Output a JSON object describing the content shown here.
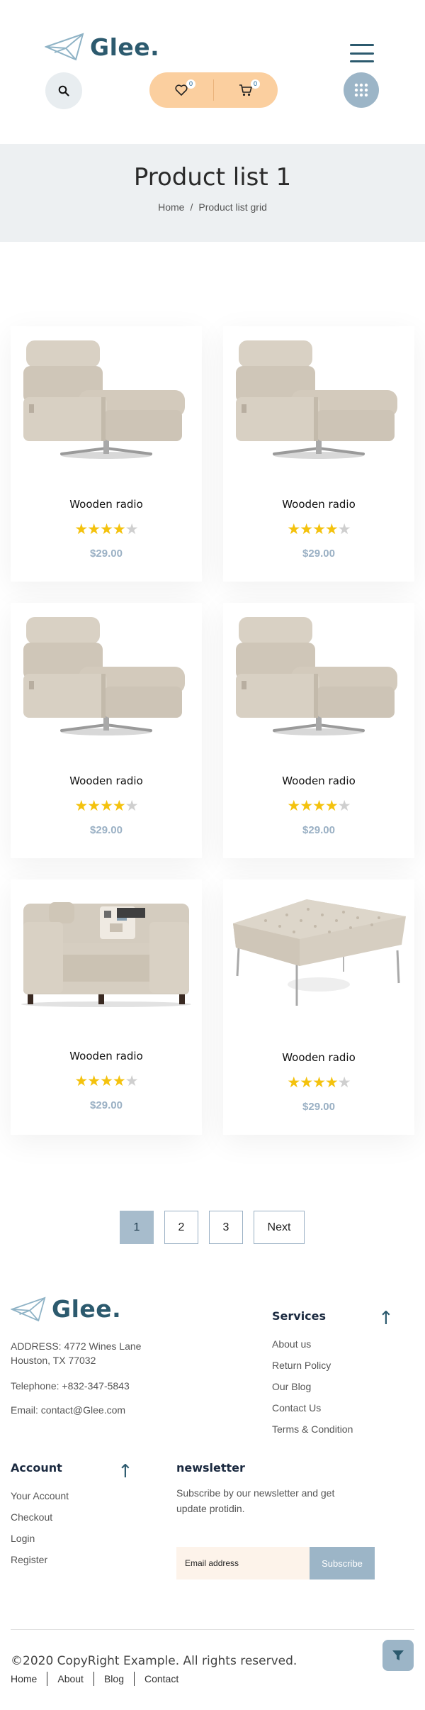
{
  "header": {
    "logo_text": "Glee.",
    "wishlist_count": "0",
    "cart_count": "0",
    "icons": {
      "search": "search-icon",
      "wishlist": "heart-icon",
      "cart": "cart-icon",
      "menu": "hamburger-icon",
      "apps": "grid-icon"
    },
    "colors": {
      "brand": "#2c5a6e",
      "pill": "#fbcf9f",
      "accent": "#9cb5c7"
    }
  },
  "banner": {
    "title": "Product list 1",
    "breadcrumb": [
      "Home",
      "/",
      "Product list grid"
    ]
  },
  "products": [
    {
      "name": "Wooden radio",
      "rating": 4,
      "max_rating": 5,
      "price": "$29.00",
      "image": "armchair-image"
    },
    {
      "name": "Wooden radio",
      "rating": 4,
      "max_rating": 5,
      "price": "$29.00",
      "image": "armchair-image"
    },
    {
      "name": "Wooden radio",
      "rating": 4,
      "max_rating": 5,
      "price": "$29.00",
      "image": "armchair-image"
    },
    {
      "name": "Wooden radio",
      "rating": 4,
      "max_rating": 5,
      "price": "$29.00",
      "image": "armchair-image"
    },
    {
      "name": "Wooden radio",
      "rating": 4,
      "max_rating": 5,
      "price": "$29.00",
      "image": "sofa-image"
    },
    {
      "name": "Wooden radio",
      "rating": 4,
      "max_rating": 5,
      "price": "$29.00",
      "image": "ottoman-image"
    }
  ],
  "pagination": {
    "pages": [
      "1",
      "2",
      "3"
    ],
    "current": "1",
    "next_label": "Next"
  },
  "footer": {
    "logo_text": "Glee.",
    "address_line1": "ADDRESS: 4772 Wines Lane",
    "address_line2": "Houston, TX 77032",
    "telephone": "Telephone: +832-347-5843",
    "email": "Email: contact@Glee.com",
    "services": {
      "heading": "Services",
      "links": [
        "About us",
        "Return Policy",
        "Our Blog",
        "Contact Us",
        "Terms & Condition"
      ]
    },
    "account": {
      "heading": "Account",
      "links": [
        "Your Account",
        "Checkout",
        "Login",
        "Register"
      ]
    },
    "newsletter": {
      "heading": "newsletter",
      "text_line1": "Subscribe by our newsletter and get",
      "text_line2": "update protidin.",
      "placeholder": "Email address",
      "button": "Subscribe"
    },
    "copyright": "©2020 CopyRight Example. All rights reserved.",
    "bottom_links": [
      "Home",
      "About",
      "Blog",
      "Contact"
    ]
  }
}
